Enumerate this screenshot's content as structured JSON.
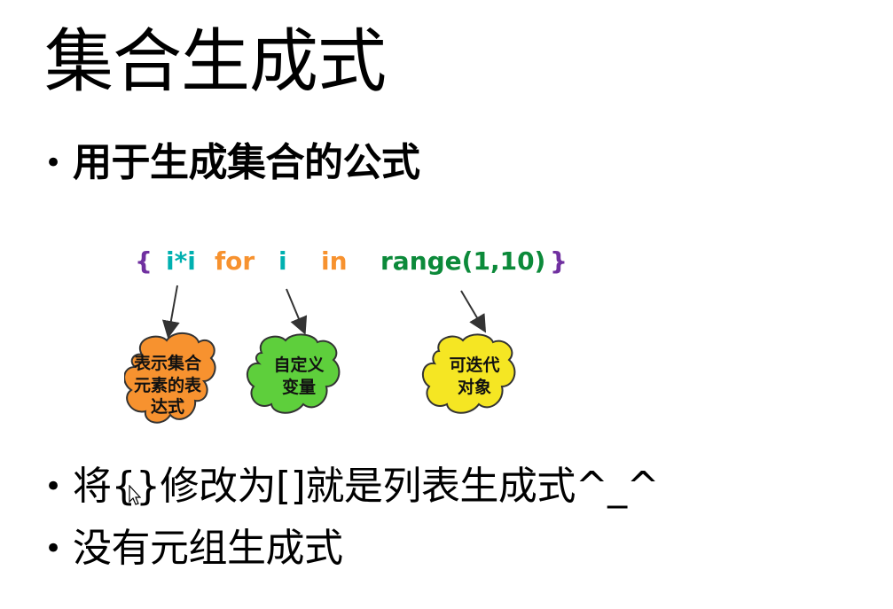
{
  "slide": {
    "title": "集合生成式",
    "bullets": [
      "用于生成集合的公式",
      "将{}修改为[]就是列表生成式^_^",
      "没有元组生成式"
    ]
  },
  "diagram": {
    "code": {
      "open_brace": "{",
      "expression": "i*i",
      "kw_for": "for",
      "variable": "i",
      "kw_in": "in",
      "iterable": "range(1,10)",
      "close_brace": "}"
    },
    "clouds": [
      {
        "label": "表示集合元素的表达式",
        "color": "#f7922f"
      },
      {
        "label": "自定义变量",
        "color": "#5ecf3c"
      },
      {
        "label": "可迭代对象",
        "color": "#f5e623"
      }
    ]
  },
  "colors": {
    "brace": "#7030a0",
    "expression": "#00b0b0",
    "keyword": "#f7922f",
    "variable": "#00b0b0",
    "iterable": "#0c8a3a"
  }
}
